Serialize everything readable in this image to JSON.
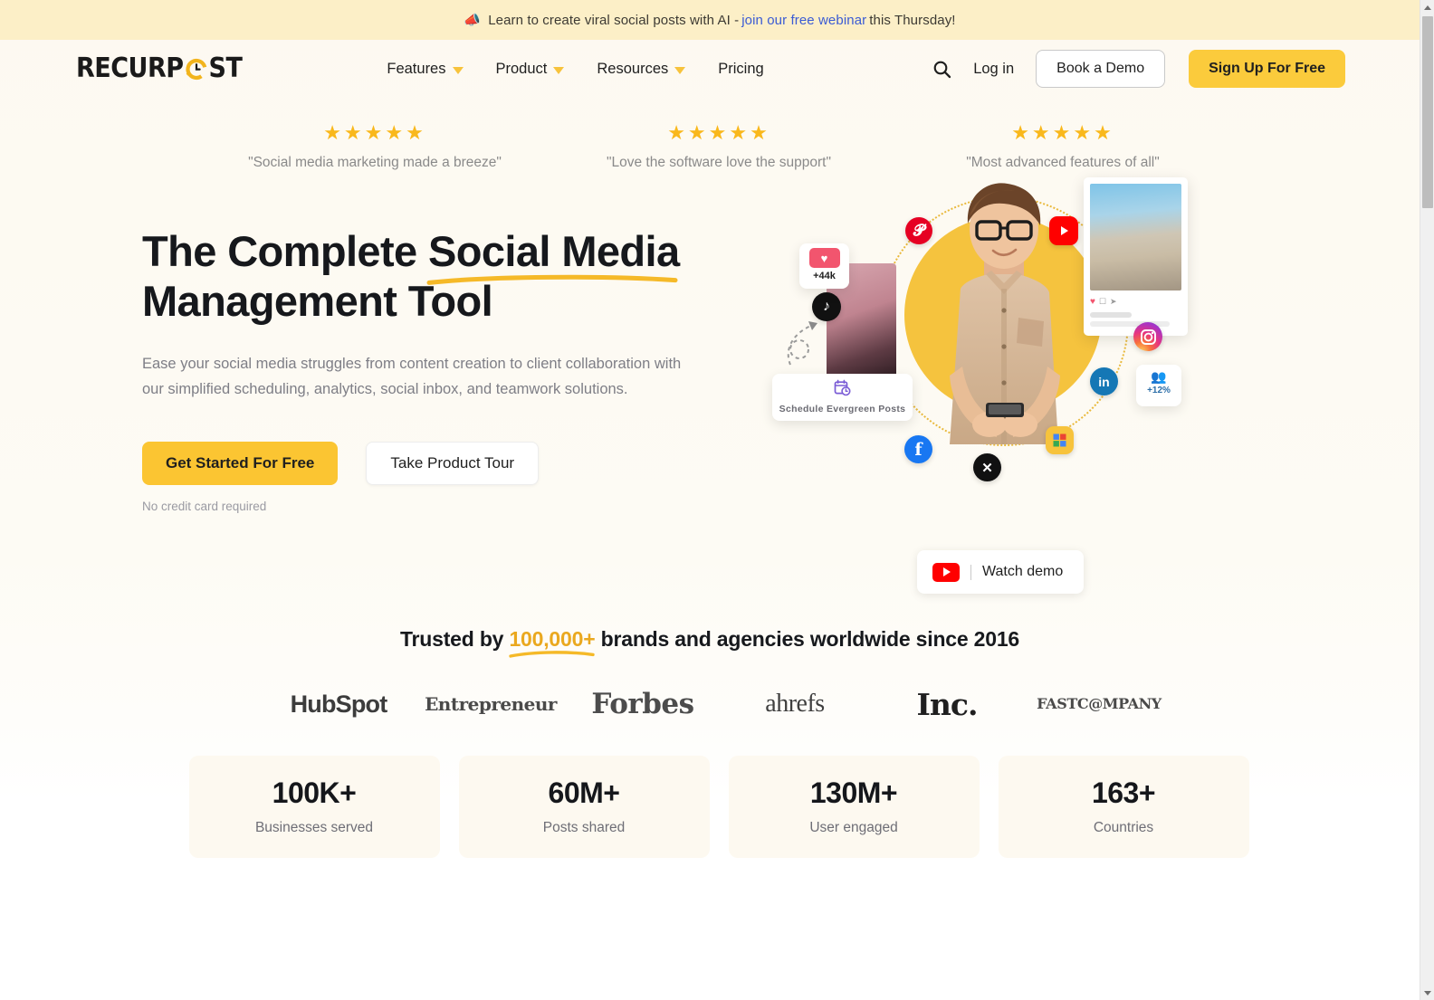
{
  "banner": {
    "icon": "megaphone-icon",
    "text_before": "Learn to create viral social posts with AI -",
    "link_text": "join our free webinar",
    "text_after": "this Thursday!"
  },
  "header": {
    "logo_text_1": "RECURP",
    "logo_icon": "recurpost-clock-icon",
    "logo_text_2": "ST",
    "nav": [
      {
        "label": "Features",
        "has_dropdown": true
      },
      {
        "label": "Product",
        "has_dropdown": true
      },
      {
        "label": "Resources",
        "has_dropdown": true
      },
      {
        "label": "Pricing",
        "has_dropdown": false
      }
    ],
    "search_icon": "search-icon",
    "login_label": "Log in",
    "demo_label": "Book a Demo",
    "signup_label": "Sign Up For Free"
  },
  "reviews": [
    {
      "stars": "★★★★★",
      "rating": 5,
      "quote": "\"Social media marketing made a breeze\""
    },
    {
      "stars": "★★★★★",
      "rating": 5,
      "quote": "\"Love the software love the support\""
    },
    {
      "stars": "★★★★★",
      "rating": 5,
      "quote": "\"Most advanced features of all\""
    }
  ],
  "hero": {
    "title_part1": "The Complete ",
    "title_highlight": "Social Media",
    "title_part2": "Management Tool",
    "subtitle": "Ease your social media struggles from content creation to client collaboration with our simplified scheduling, analytics, social inbox, and teamwork solutions.",
    "cta_primary": "Get Started For Free",
    "cta_secondary": "Take Product Tour",
    "cta_note": "No credit card required",
    "art": {
      "likes_badge": "+44k",
      "likes_icon": "heart-icon",
      "followers_badge": "+12%",
      "followers_icon": "people-icon",
      "schedule_card_label": "Schedule Evergreen Posts",
      "schedule_card_icon": "calendar-clock-icon",
      "social_icons": [
        "pinterest-icon",
        "youtube-icon",
        "tiktok-icon",
        "instagram-icon",
        "linkedin-icon",
        "facebook-icon",
        "x-twitter-icon",
        "google-business-icon"
      ]
    }
  },
  "watch_demo": {
    "icon": "youtube-play-icon",
    "label": "Watch demo"
  },
  "trusted": {
    "text_before": "Trusted by ",
    "highlight": "100,000+",
    "text_after": " brands and agencies worldwide since 2016",
    "brands": [
      {
        "name": "HubSpot",
        "style": "b-hubspot"
      },
      {
        "name": "Entrepreneur",
        "style": "b-entrepreneur"
      },
      {
        "name": "Forbes",
        "style": "b-forbes"
      },
      {
        "name": "ahrefs",
        "style": "b-ahrefs"
      },
      {
        "name": "Inc.",
        "style": "b-inc"
      },
      {
        "name": "FASTC@MPANY",
        "style": "b-fastcompany"
      }
    ]
  },
  "stats": [
    {
      "value": "100K+",
      "label": "Businesses served"
    },
    {
      "value": "60M+",
      "label": "Posts shared"
    },
    {
      "value": "130M+",
      "label": "User engaged"
    },
    {
      "value": "163+",
      "label": "Countries"
    }
  ],
  "colors": {
    "brand_yellow": "#FBC532",
    "banner_bg": "#FCEFC7",
    "page_bg": "#FDF9F1",
    "link_blue": "#3B5BD4",
    "star_gold": "#F9B81C",
    "text_dark": "#16181C",
    "text_muted": "#7E7E86"
  }
}
